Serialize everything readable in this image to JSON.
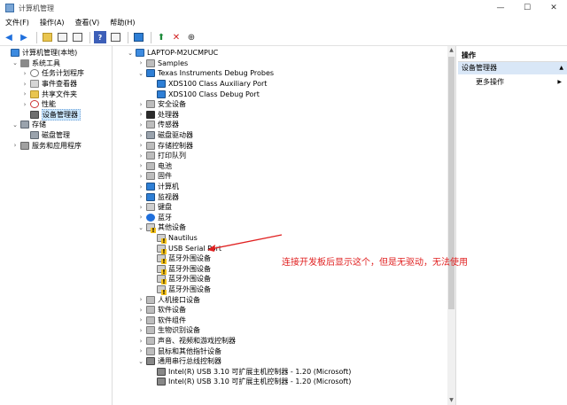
{
  "window": {
    "title": "计算机管理",
    "buttons": [
      "—",
      "☐",
      "✕"
    ]
  },
  "menu": [
    "文件(F)",
    "操作(A)",
    "查看(V)",
    "帮助(H)"
  ],
  "left_tree": [
    {
      "label": "计算机管理(本地)",
      "indent": 0,
      "exp": "",
      "icon": "pc"
    },
    {
      "label": "系统工具",
      "indent": 1,
      "exp": "⌄",
      "icon": "tool"
    },
    {
      "label": "任务计划程序",
      "indent": 2,
      "exp": "›",
      "icon": "clock"
    },
    {
      "label": "事件查看器",
      "indent": 2,
      "exp": "›",
      "icon": "log"
    },
    {
      "label": "共享文件夹",
      "indent": 2,
      "exp": "›",
      "icon": "folder"
    },
    {
      "label": "性能",
      "indent": 2,
      "exp": "›",
      "icon": "perf"
    },
    {
      "label": "设备管理器",
      "indent": 2,
      "exp": "",
      "icon": "dev",
      "selected": true
    },
    {
      "label": "存储",
      "indent": 1,
      "exp": "⌄",
      "icon": "disk"
    },
    {
      "label": "磁盘管理",
      "indent": 2,
      "exp": "",
      "icon": "disk"
    },
    {
      "label": "服务和应用程序",
      "indent": 1,
      "exp": "›",
      "icon": "svc"
    }
  ],
  "device_tree": [
    {
      "label": "LAPTOP-M2UCMPUC",
      "indent": 0,
      "exp": "⌄",
      "icon": "pc"
    },
    {
      "label": "Samples",
      "indent": 1,
      "exp": "›",
      "icon": "gray"
    },
    {
      "label": "Texas Instruments Debug Probes",
      "indent": 1,
      "exp": "⌄",
      "icon": "mon"
    },
    {
      "label": "XDS100 Class Auxiliary Port",
      "indent": 2,
      "exp": "",
      "icon": "mon"
    },
    {
      "label": "XDS100 Class Debug Port",
      "indent": 2,
      "exp": "",
      "icon": "mon"
    },
    {
      "label": "安全设备",
      "indent": 1,
      "exp": "›",
      "icon": "gray"
    },
    {
      "label": "处理器",
      "indent": 1,
      "exp": "›",
      "icon": "chip"
    },
    {
      "label": "传感器",
      "indent": 1,
      "exp": "›",
      "icon": "gray"
    },
    {
      "label": "磁盘驱动器",
      "indent": 1,
      "exp": "›",
      "icon": "disk"
    },
    {
      "label": "存储控制器",
      "indent": 1,
      "exp": "›",
      "icon": "gray"
    },
    {
      "label": "打印队列",
      "indent": 1,
      "exp": "›",
      "icon": "gray"
    },
    {
      "label": "电池",
      "indent": 1,
      "exp": "›",
      "icon": "gray"
    },
    {
      "label": "固件",
      "indent": 1,
      "exp": "›",
      "icon": "gray"
    },
    {
      "label": "计算机",
      "indent": 1,
      "exp": "›",
      "icon": "mon"
    },
    {
      "label": "监视器",
      "indent": 1,
      "exp": "›",
      "icon": "mon"
    },
    {
      "label": "键盘",
      "indent": 1,
      "exp": "›",
      "icon": "kb"
    },
    {
      "label": "蓝牙",
      "indent": 1,
      "exp": "›",
      "icon": "bt"
    },
    {
      "label": "其他设备",
      "indent": 1,
      "exp": "⌄",
      "icon": "warn"
    },
    {
      "label": "Nautilus",
      "indent": 2,
      "exp": "",
      "icon": "warn"
    },
    {
      "label": "USB Serial Port",
      "indent": 2,
      "exp": "",
      "icon": "warn"
    },
    {
      "label": "蓝牙外围设备",
      "indent": 2,
      "exp": "",
      "icon": "warn"
    },
    {
      "label": "蓝牙外围设备",
      "indent": 2,
      "exp": "",
      "icon": "warn"
    },
    {
      "label": "蓝牙外围设备",
      "indent": 2,
      "exp": "",
      "icon": "warn"
    },
    {
      "label": "蓝牙外围设备",
      "indent": 2,
      "exp": "",
      "icon": "warn"
    },
    {
      "label": "人机接口设备",
      "indent": 1,
      "exp": "›",
      "icon": "gray"
    },
    {
      "label": "软件设备",
      "indent": 1,
      "exp": "›",
      "icon": "gray"
    },
    {
      "label": "软件组件",
      "indent": 1,
      "exp": "›",
      "icon": "gray"
    },
    {
      "label": "生物识别设备",
      "indent": 1,
      "exp": "›",
      "icon": "gray"
    },
    {
      "label": "声音、视频和游戏控制器",
      "indent": 1,
      "exp": "›",
      "icon": "gray"
    },
    {
      "label": "鼠标和其他指针设备",
      "indent": 1,
      "exp": "›",
      "icon": "gray"
    },
    {
      "label": "通用串行总线控制器",
      "indent": 1,
      "exp": "⌄",
      "icon": "usb"
    },
    {
      "label": "Intel(R) USB 3.10 可扩展主机控制器 - 1.20 (Microsoft)",
      "indent": 2,
      "exp": "",
      "icon": "usb"
    },
    {
      "label": "Intel(R) USB 3.10 可扩展主机控制器 - 1.20 (Microsoft)",
      "indent": 2,
      "exp": "",
      "icon": "usb"
    }
  ],
  "actions": {
    "header": "操作",
    "section": "设备管理器",
    "item": "更多操作"
  },
  "annotation": "连接开发板后显示这个，但是无驱动，无法使用",
  "colors": {
    "selection": "#cce8ff",
    "annotation": "#e02020"
  }
}
